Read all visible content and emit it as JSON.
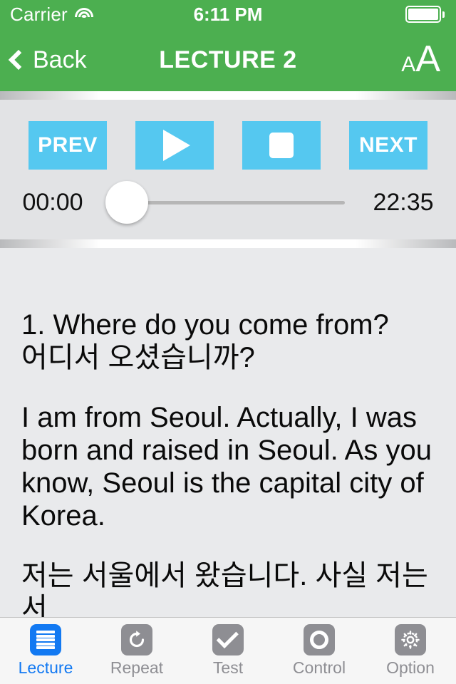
{
  "status_bar": {
    "carrier": "Carrier",
    "wifi_icon": "wifi-icon",
    "time": "6:11 PM",
    "battery_icon": "battery-full-icon"
  },
  "nav_bar": {
    "back_label": "Back",
    "back_icon": "chevron-left-icon",
    "title": "LECTURE 2",
    "font_size_small": "A",
    "font_size_large": "A"
  },
  "player": {
    "buttons": [
      {
        "name": "prev-button",
        "label": "PREV",
        "icon": ""
      },
      {
        "name": "play-button",
        "label": "",
        "icon": "play-icon"
      },
      {
        "name": "stop-button",
        "label": "",
        "icon": "stop-icon"
      },
      {
        "name": "next-button",
        "label": "NEXT",
        "icon": ""
      }
    ],
    "current_time": "00:00",
    "total_time": "22:35",
    "progress_percent": 0
  },
  "content": {
    "paragraphs": [
      "1. Where do you come from?\n어디서 오셨습니까?",
      "I am from Seoul. Actually, I was born and raised in Seoul. As you know, Seoul is the capital city of Korea.",
      "저는 서울에서 왔습니다. 사실 저는 서"
    ]
  },
  "tab_bar": {
    "items": [
      {
        "label": "Lecture",
        "icon": "list-lines-icon",
        "active": true
      },
      {
        "label": "Repeat",
        "icon": "refresh-icon",
        "active": false
      },
      {
        "label": "Test",
        "icon": "checkmark-icon",
        "active": false
      },
      {
        "label": "Control",
        "icon": "circle-ring-icon",
        "active": false
      },
      {
        "label": "Option",
        "icon": "gear-icon",
        "active": false
      }
    ]
  },
  "colors": {
    "header_green": "#4CAF50",
    "button_blue": "#55C8F0",
    "active_tab_blue": "#1279F2",
    "inactive_gray": "#8E8E93",
    "content_bg": "#E9EAEC",
    "player_bg": "#E2E3E5"
  }
}
